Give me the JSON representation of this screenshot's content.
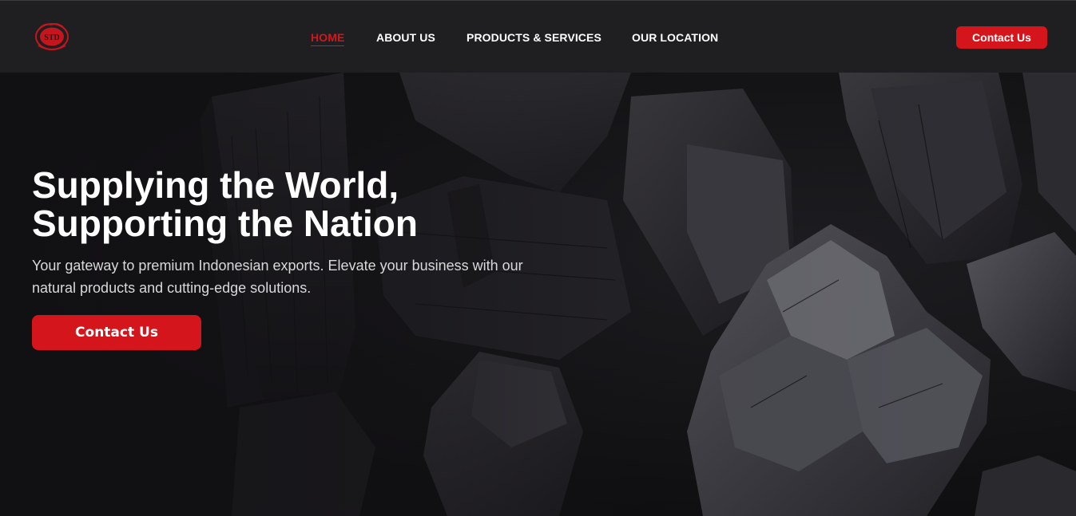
{
  "brand": {
    "logo_icon": "company-seal-logo",
    "logo_text": "STD",
    "accent_color": "#d4161c"
  },
  "nav": {
    "items": [
      {
        "label": "HOME",
        "active": true
      },
      {
        "label": "ABOUT US",
        "active": false
      },
      {
        "label": "PRODUCTS & SERVICES",
        "active": false
      },
      {
        "label": "OUR LOCATION",
        "active": false
      }
    ]
  },
  "header": {
    "cta_label": "Contact Us"
  },
  "hero": {
    "title_line1": "Supplying the World,",
    "title_line2": "Supporting the Nation",
    "subtitle": "Your gateway to premium Indonesian exports. Elevate your business with our natural products and cutting-edge solutions.",
    "cta_label": "Contact Us",
    "background": "charcoal-pieces-image"
  }
}
